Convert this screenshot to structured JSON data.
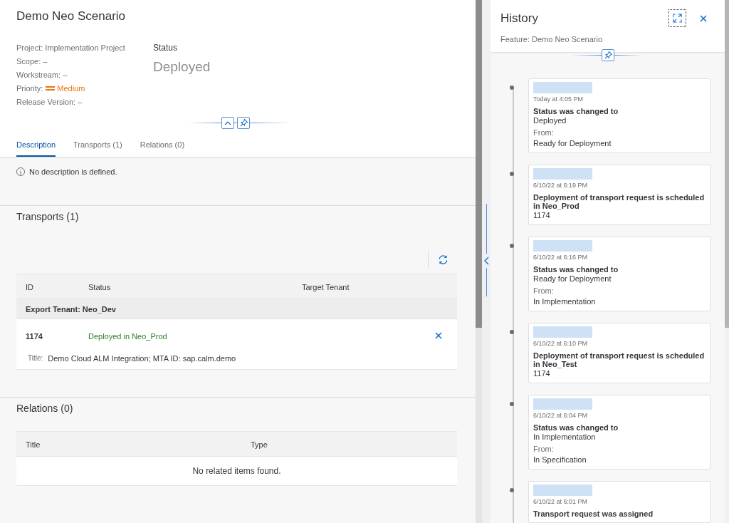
{
  "header": {
    "title": "Demo Neo Scenario",
    "fields": [
      {
        "kind": "plain",
        "text": "Project: Implementation Project"
      },
      {
        "kind": "plain",
        "text": "Scope: –"
      },
      {
        "kind": "plain",
        "text": "Workstream: –"
      },
      {
        "kind": "priority",
        "label": "Priority:",
        "value": "Medium"
      },
      {
        "kind": "plain",
        "text": "Release Version: –"
      }
    ],
    "status": {
      "label": "Status",
      "value": "Deployed"
    }
  },
  "tabs": [
    {
      "label": "Description",
      "selected": true
    },
    {
      "label": "Transports (1)",
      "selected": false
    },
    {
      "label": "Relations (0)",
      "selected": false
    }
  ],
  "description": "No description is defined.",
  "transports": {
    "title": "Transports (1)",
    "columns": [
      "ID",
      "Status",
      "Target Tenant"
    ],
    "groups": [
      {
        "title": "Export Tenant: Neo_Dev",
        "rows": [
          {
            "id": "1174",
            "status": "Deployed in Neo_Prod",
            "detail_label": "Title:",
            "detail_value": "Demo Cloud ALM Integration; MTA ID: sap.calm.demo"
          }
        ]
      }
    ]
  },
  "relations": {
    "title": "Relations (0)",
    "columns": [
      "Title",
      "Type"
    ],
    "empty": "No related items found."
  },
  "history": {
    "title": "History",
    "subtitle": "Feature: Demo Neo Scenario",
    "entries": [
      {
        "date": "Today at 4:05 PM",
        "title": "Status was changed to",
        "value": "Deployed",
        "from_label": "From:",
        "from_value": "Ready for Deployment"
      },
      {
        "date": "6/10/22 at 6:19 PM",
        "title": "Deployment of transport request is scheduled in Neo_Prod",
        "value": "1174"
      },
      {
        "date": "6/10/22 at 6:16 PM",
        "title": "Status was changed to",
        "value": "Ready for Deployment",
        "from_label": "From:",
        "from_value": "In Implementation"
      },
      {
        "date": "6/10/22 at 6:10 PM",
        "title": "Deployment of transport request is scheduled in Neo_Test",
        "value": "1174"
      },
      {
        "date": "6/10/22 at 6:04 PM",
        "title": "Status was changed to",
        "value": "In Implementation",
        "from_label": "From:",
        "from_value": "In Specification"
      },
      {
        "date": "6/10/22 at 6:01 PM",
        "title": "Transport request was assigned"
      }
    ]
  }
}
